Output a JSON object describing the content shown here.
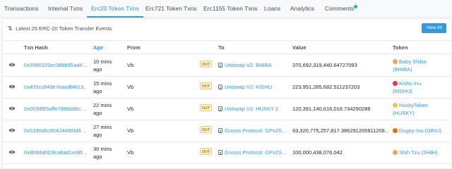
{
  "tabs": [
    {
      "label": "Transactions"
    },
    {
      "label": "Internal Txns"
    },
    {
      "label": "Erc20 Token Txns"
    },
    {
      "label": "Erc721 Token Txns"
    },
    {
      "label": "Erc1155 Token Txns"
    },
    {
      "label": "Loans"
    },
    {
      "label": "Analytics"
    },
    {
      "label": "Comments"
    }
  ],
  "summary": {
    "text": "Latest 25 ERC-20 Token Transfer Events"
  },
  "view_all": "View All",
  "table": {
    "headers": {
      "txn_hash": "Txn Hash",
      "age": "Age",
      "from": "From",
      "to": "To",
      "value": "Value",
      "token": "Token"
    },
    "rows": [
      {
        "txn_hash": "0x3086325ec36bb85ad4…",
        "age_line1": "10 mins",
        "age_line2": "ago",
        "from": "Vb",
        "direction": "OUT",
        "to": "Uniswap V2: BHIBA",
        "value": "370,692,319,440.64727093",
        "token_line1": "Baby Shiba",
        "token_line2": "(BHIBA)",
        "token_color": "#f4a261"
      },
      {
        "txn_hash": "0x401cc84de7eaodf4813…",
        "age_line1": "15 mins",
        "age_line2": "ago",
        "from": "Vb",
        "direction": "OUT",
        "to": "Uniswap V2: KISHU",
        "value": "223,951,265,682.511237203",
        "token_line1": "Kishu Inu",
        "token_line2": "(KISHU)",
        "token_color": "#e63946"
      },
      {
        "txn_hash": "0x0f2fdf95affe788bb8bc…",
        "age_line1": "22 mins",
        "age_line2": "ago",
        "from": "Vb",
        "direction": "OUT",
        "to": "Uniswap V2: HUSKY 2",
        "value": "120,391,140,616,016.734290288",
        "token_line1": "HuskyToken",
        "token_line2": "(HUSKY)",
        "token_color": "#e9c46a"
      },
      {
        "txn_hash": "0x5190d6c85424496fd8…",
        "age_line1": "27 mins",
        "age_line2": "ago",
        "from": "Vb",
        "direction": "OUT",
        "to": "Gnosis Protocol: GPv2S…",
        "value": "93,320,775,257,817.386291205811208…",
        "token_line1": "Dogey-Inu (DINU)",
        "token_line2": "",
        "token_color": "#d97706"
      },
      {
        "txn_hash": "0x8b9dafd28ca6ad1ed8f…",
        "age_line1": "30 mins",
        "age_line2": "ago",
        "from": "Vb",
        "direction": "OUT",
        "to": "Gnosis Protocol: GPv2S…",
        "value": "100,000,438,076,042",
        "token_line1": "Shih Tzu (SHIH)",
        "token_line2": "",
        "token_color": "#f4a261"
      }
    ]
  }
}
